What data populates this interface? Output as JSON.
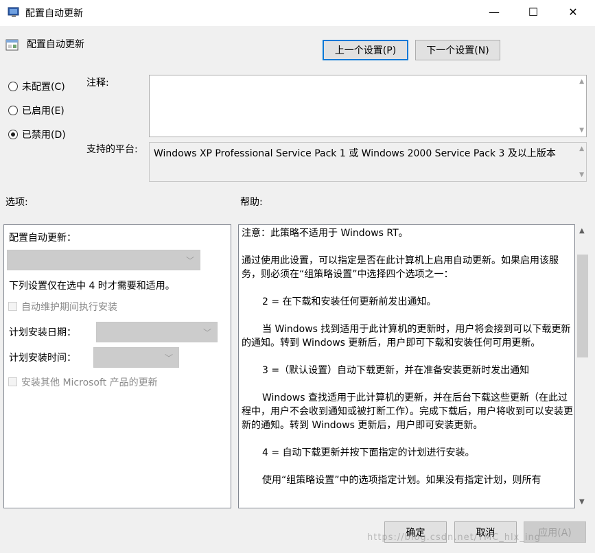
{
  "window": {
    "title": "配置自动更新",
    "minimize_glyph": "—",
    "maximize_glyph": "☐",
    "close_glyph": "✕"
  },
  "header": {
    "title": "配置自动更新",
    "prev_button": "上一个设置(P)",
    "next_button": "下一个设置(N)"
  },
  "state": {
    "not_configured": "未配置(C)",
    "enabled": "已启用(E)",
    "disabled": "已禁用(D)",
    "selected": "disabled"
  },
  "comment": {
    "label": "注释:",
    "value": ""
  },
  "platform": {
    "label": "支持的平台:",
    "value": "Windows XP Professional Service Pack 1 或 Windows 2000 Service Pack 3 及以上版本"
  },
  "options": {
    "heading": "选项:",
    "configure_label": "配置自动更新：",
    "note": "下列设置仅在选中 4 时才需要和适用。",
    "maintenance_checkbox": "自动维护期间执行安装",
    "install_day_label": "计划安装日期：",
    "install_time_label": "计划安装时间：",
    "other_products_checkbox": "安装其他 Microsoft 产品的更新"
  },
  "help": {
    "heading": "帮助:",
    "paragraphs": [
      "注意：此策略不适用于 Windows RT。",
      "通过使用此设置，可以指定是否在此计算机上启用自动更新。如果启用该服务，则必须在“组策略设置”中选择四个选项之一：",
      "2 = 在下载和安装任何更新前发出通知。",
      "当 Windows 找到适用于此计算机的更新时，用户将会接到可以下载更新的通知。转到 Windows 更新后，用户即可下载和安装任何可用更新。",
      "3 =（默认设置）自动下载更新，并在准备安装更新时发出通知",
      "Windows 查找适用于此计算机的更新，并在后台下载这些更新（在此过程中，用户不会收到通知或被打断工作）。完成下载后，用户将收到可以安装更新的通知。转到 Windows 更新后，用户即可安装更新。",
      "4 = 自动下载更新并按下面指定的计划进行安装。",
      "使用“组策略设置”中的选项指定计划。如果没有指定计划，则所有"
    ]
  },
  "footer": {
    "ok": "确定",
    "cancel": "取消",
    "apply": "应用(A)",
    "watermark": "https://blog.csdn.net/TMC_hlx_ing"
  }
}
